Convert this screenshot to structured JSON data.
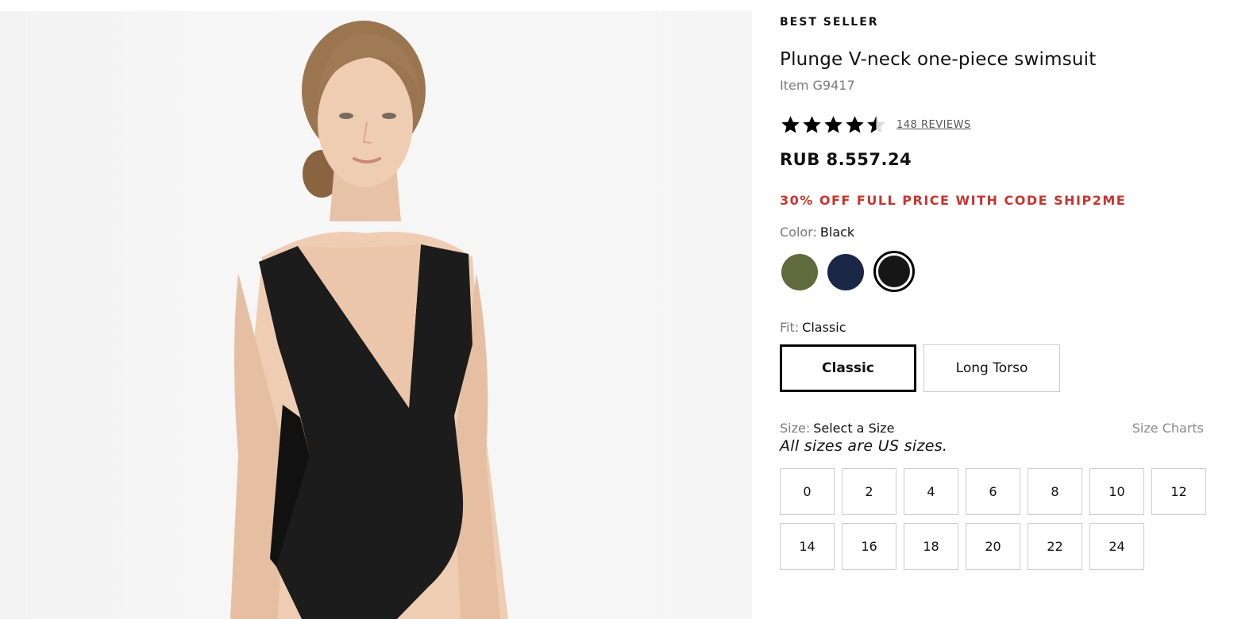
{
  "product": {
    "badge": "BEST SELLER",
    "title": "Plunge V-neck one-piece swimsuit",
    "item_number": "Item G9417",
    "rating": 4.5,
    "reviews_link": "148 REVIEWS",
    "price": "RUB 8.557.24",
    "promo": "30% OFF FULL PRICE WITH CODE SHIP2ME"
  },
  "color": {
    "label": "Color:",
    "selected": "Black",
    "swatches": [
      {
        "name": "olive",
        "hex": "#5f6b3c"
      },
      {
        "name": "navy",
        "hex": "#1a2746"
      },
      {
        "name": "black",
        "hex": "#161616"
      }
    ]
  },
  "fit": {
    "label": "Fit:",
    "selected": "Classic",
    "options": [
      "Classic",
      "Long Torso"
    ]
  },
  "size": {
    "label": "Size:",
    "selected": "Select a Size",
    "charts_link": "Size Charts",
    "note": "All sizes are US sizes.",
    "options": [
      "0",
      "2",
      "4",
      "6",
      "8",
      "10",
      "12",
      "14",
      "16",
      "18",
      "20",
      "22",
      "24"
    ]
  },
  "colors": {
    "promo_red": "#c8352f",
    "star_filled": "#000000",
    "star_empty": "#d9d9d9"
  }
}
